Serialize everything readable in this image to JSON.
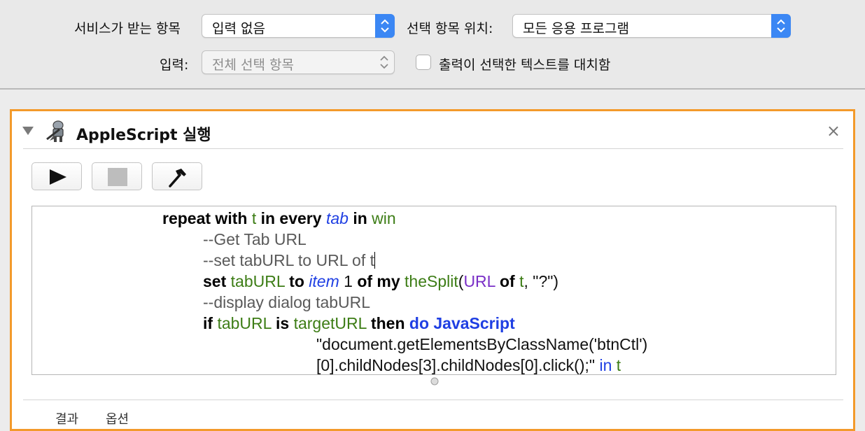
{
  "top": {
    "service_label": "서비스가 받는 항목",
    "service_value": "입력 없음",
    "location_label": "선택 항목 위치:",
    "location_value": "모든 응용 프로그램",
    "input_label": "입력:",
    "input_value": "전체 선택 항목",
    "replace_label": "출력이 선택한 텍스트를 대치함"
  },
  "action": {
    "title": "AppleScript 실행",
    "close": "×",
    "run_icon": "play-icon",
    "stop_icon": "stop-icon",
    "compile_icon": "hammer-icon"
  },
  "code": {
    "l1": {
      "a": "repeat with",
      "b": "t",
      "c": "in every",
      "d": "tab",
      "e": "in",
      "f": "win"
    },
    "l2": "--Get Tab URL",
    "l3": "--set tabURL to URL of t",
    "l4": {
      "a": "set",
      "b": "tabURL",
      "c": "to",
      "d": "item",
      "e": "1",
      "f": "of my",
      "g": "theSplit",
      "h": "(",
      "i": "URL",
      "j": "of",
      "k": "t",
      "l": ", \"?\")"
    },
    "l5": "--display dialog tabURL",
    "l6": {
      "a": "if",
      "b": "tabURL",
      "c": "is",
      "d": "targetURL",
      "e": "then",
      "f": "do JavaScript"
    },
    "l7": "\"document.getElementsByClassName('btnCtl')",
    "l8": {
      "a": "[0].childNodes[3].childNodes[0].click();\"",
      "b": "in",
      "c": "t"
    }
  },
  "tabs": {
    "results": "결과",
    "options": "옵션"
  },
  "colors": {
    "accent_border": "#f39a2b",
    "select_blue": "#3b87f4"
  }
}
